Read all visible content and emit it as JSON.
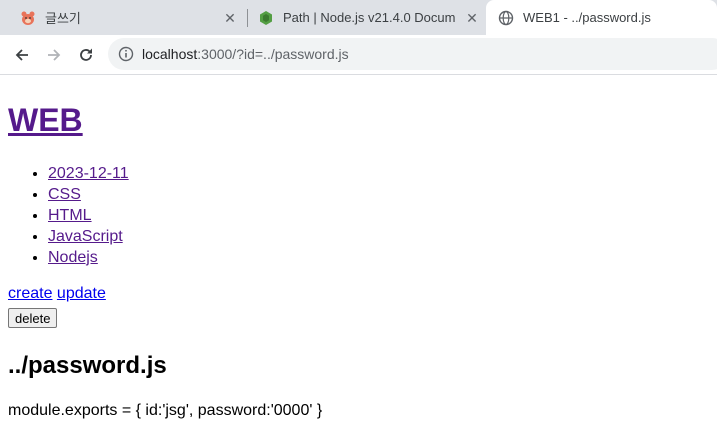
{
  "browser": {
    "tabs": [
      {
        "title": "글쓰기",
        "active": false
      },
      {
        "title": "Path | Node.js v21.4.0 Docum",
        "active": false
      },
      {
        "title": "WEB1 - ../password.js",
        "active": true
      }
    ],
    "address": {
      "host": "localhost",
      "rest": ":3000/?id=../password.js"
    },
    "colors": {
      "tabstrip": "#dee1e6",
      "omnibox": "#f1f3f4",
      "nodejs": "#539e43"
    }
  },
  "page": {
    "site_title": "WEB",
    "topics": [
      "2023-12-11",
      "CSS",
      "HTML",
      "JavaScript",
      "Nodejs"
    ],
    "create_label": "create",
    "update_label": "update",
    "delete_label": "delete",
    "doc_title": "../password.js",
    "doc_body": "module.exports = { id:'jsg', password:'0000' }"
  }
}
